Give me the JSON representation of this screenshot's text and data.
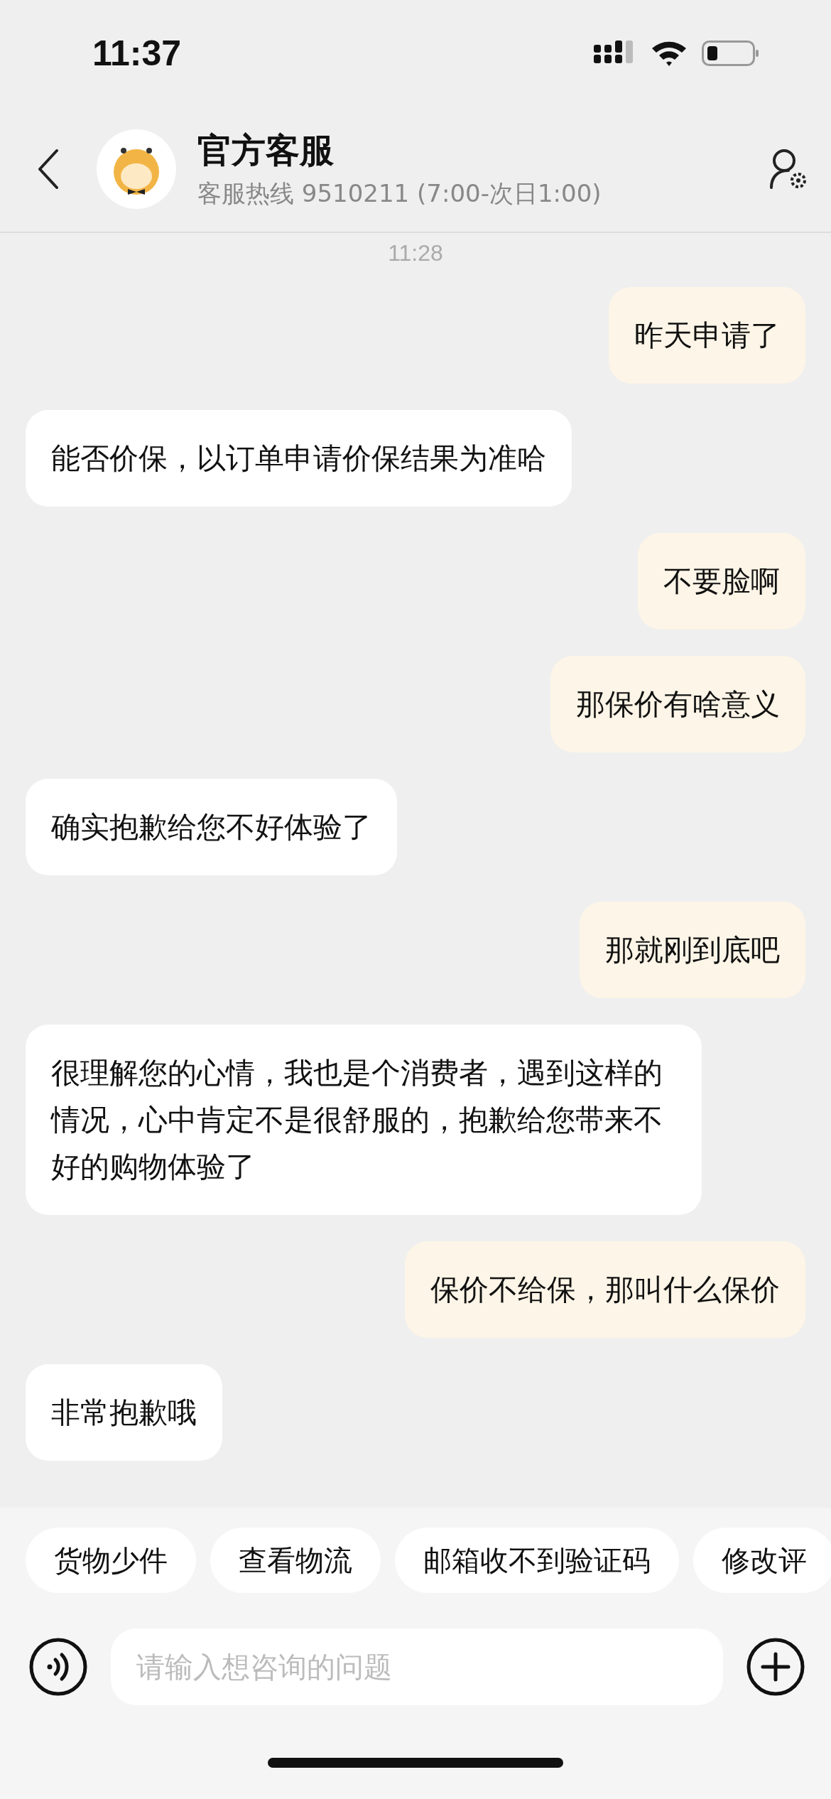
{
  "status_bar": {
    "time": "11:37"
  },
  "header": {
    "title": "官方客服",
    "subtitle": "客服热线 9510211 (7:00-次日1:00)"
  },
  "timestamp": "11:28",
  "messages": [
    {
      "kind": "sent",
      "text": "昨天申请了"
    },
    {
      "kind": "received",
      "text": "能否价保，以订单申请价保结果为准哈"
    },
    {
      "kind": "sent",
      "text": "不要脸啊"
    },
    {
      "kind": "sent",
      "text": "那保价有啥意义"
    },
    {
      "kind": "received",
      "text": "确实抱歉给您不好体验了"
    },
    {
      "kind": "sent",
      "text": "那就刚到底吧"
    },
    {
      "kind": "received",
      "text": "很理解您的心情，我也是个消费者，遇到这样的情况，心中肯定不是很舒服的，抱歉给您带来不好的购物体验了"
    },
    {
      "kind": "sent",
      "text": "保价不给保，那叫什么保价"
    },
    {
      "kind": "received",
      "text": "非常抱歉哦"
    }
  ],
  "quick_replies": [
    "货物少件",
    "查看物流",
    "邮箱收不到验证码",
    "修改评"
  ],
  "input": {
    "placeholder": "请输入想咨询的问题"
  }
}
